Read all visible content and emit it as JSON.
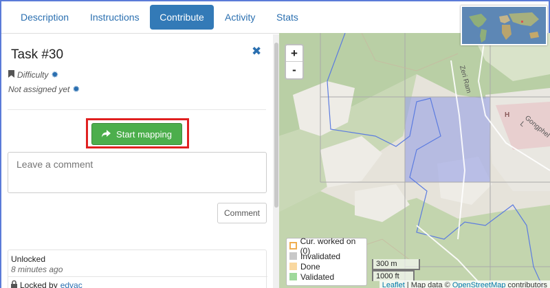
{
  "tabs": [
    {
      "label": "Description",
      "active": false
    },
    {
      "label": "Instructions",
      "active": false
    },
    {
      "label": "Contribute",
      "active": true
    },
    {
      "label": "Activity",
      "active": false
    },
    {
      "label": "Stats",
      "active": false
    }
  ],
  "task": {
    "title": "Task #30",
    "difficulty": "Difficulty",
    "assignment": "Not assigned yet",
    "start_button": "Start mapping",
    "comment_placeholder": "Leave a comment",
    "comment_button": "Comment"
  },
  "history": {
    "status": "Unlocked",
    "time": "8 minutes ago",
    "locked_by_label": "Locked by",
    "user": "edvac"
  },
  "map": {
    "zoom_in": "+",
    "zoom_out": "-",
    "labels": {
      "road": "Zeri Ram",
      "road2": "Gongphel L",
      "hospital": "H"
    },
    "legend": [
      {
        "label": "Cur. worked on (0)",
        "color": "#ffffff",
        "border": "#f0ad4e"
      },
      {
        "label": "Invalidated",
        "color": "#c8c8c8",
        "border": "#c8c8c8"
      },
      {
        "label": "Done",
        "color": "#f9d8a0",
        "border": "#f9d8a0"
      },
      {
        "label": "Validated",
        "color": "#9fd99b",
        "border": "#9fd99b"
      }
    ],
    "scale_metric": "300 m",
    "scale_imperial": "1000 ft",
    "attribution": {
      "leaflet": "Leaflet",
      "sep": " | Map data © ",
      "osm": "OpenStreetMap",
      "suffix": " contributors"
    }
  },
  "colors": {
    "accent": "#337ab7",
    "start": "#4cae4c",
    "highlight": "#e02020"
  }
}
